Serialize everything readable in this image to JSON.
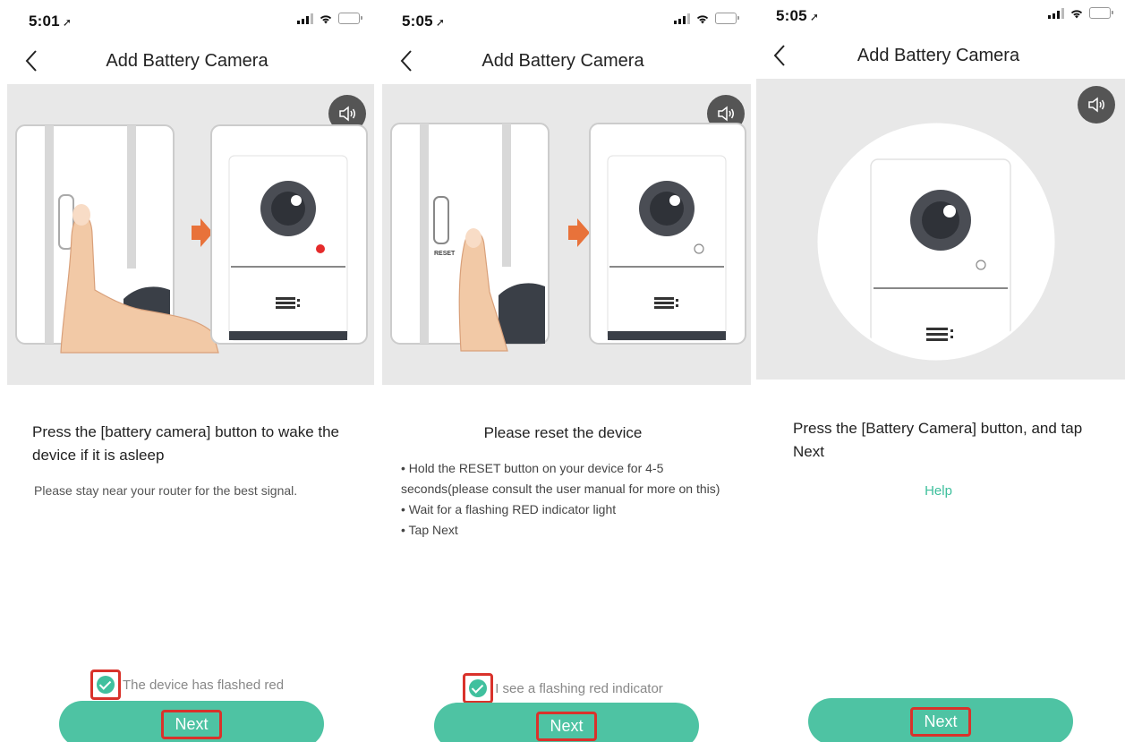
{
  "colors": {
    "accent": "#4ec3a3",
    "highlight": "#d9322b",
    "illustration_bg": "#e8e8e8",
    "indicator_red": "#e52b2b"
  },
  "screens": [
    {
      "status_time": "5:01",
      "nav_title": "Add Battery Camera",
      "icons": [
        "back-chevron-icon",
        "speaker-icon"
      ],
      "title": "Press the [battery camera] button to wake the device if it is  asleep",
      "subtitle": "Please stay near your router for the best signal.",
      "checkbox_label": "The device has flashed red",
      "next_label": "Next"
    },
    {
      "status_time": "5:05",
      "nav_title": "Add Battery Camera",
      "icons": [
        "back-chevron-icon",
        "speaker-icon"
      ],
      "title": "Please reset the device",
      "reset_label": "RESET",
      "bullets": [
        "• Hold the RESET button on your device for 4-5 seconds(please consult the user manual for more on this)",
        "• Wait for a flashing RED indicator light",
        "• Tap Next"
      ],
      "checkbox_label": "I see a flashing red indicator",
      "next_label": "Next"
    },
    {
      "status_time": "5:05",
      "nav_title": "Add Battery Camera",
      "icons": [
        "back-chevron-icon",
        "speaker-icon"
      ],
      "title": "Press the [Battery Camera] button, and tap Next",
      "help_label": "Help",
      "next_label": "Next"
    }
  ]
}
